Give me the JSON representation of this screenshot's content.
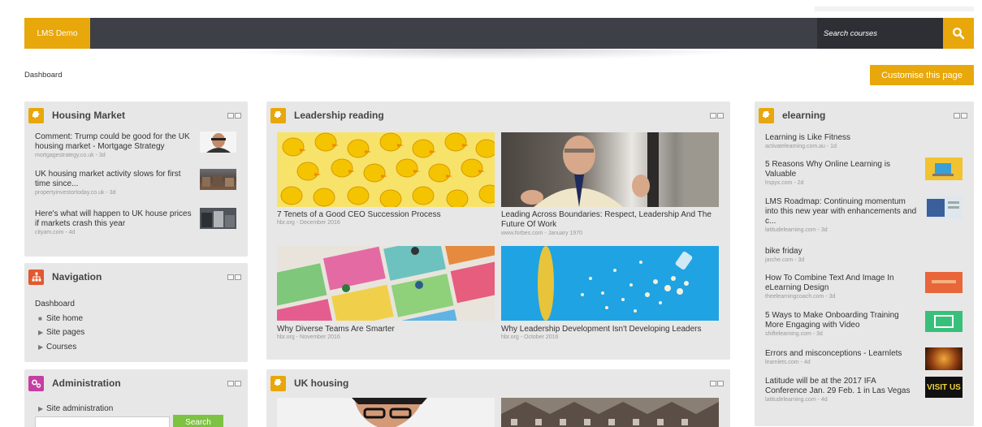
{
  "colors": {
    "accent": "#e8a70b",
    "navbar": "#3d4047",
    "panel": "#e7e7e7",
    "nav_icon": "#e2582f",
    "admin_icon": "#c63ea2",
    "go_button": "#7dc243"
  },
  "navbar": {
    "brand": "LMS Demo",
    "search_placeholder": "Search courses",
    "search_icon": "magnifier-icon"
  },
  "page": {
    "breadcrumb": "Dashboard",
    "customise_label": "Customise this page"
  },
  "housing": {
    "title": "Housing Market",
    "items": [
      {
        "title": "Comment: Trump could be good for the UK housing market - Mortgage Strategy",
        "meta": "mortgagestrategy.co.uk - 3d"
      },
      {
        "title": "UK housing market activity slows for first time since...",
        "meta": "propertyinvestortoday.co.uk - 3d"
      },
      {
        "title": "Here's what will happen to UK house prices if markets crash this year",
        "meta": "cityam.com - 4d"
      }
    ]
  },
  "navigation": {
    "title": "Navigation",
    "root": "Dashboard",
    "items": [
      {
        "label": "Site home"
      },
      {
        "label": "Site pages"
      },
      {
        "label": "Courses"
      }
    ]
  },
  "administration": {
    "title": "Administration",
    "item": "Site administration",
    "search_label": "Search"
  },
  "leadership": {
    "title": "Leadership reading",
    "cards": [
      {
        "title": "7 Tenets of a Good CEO Succession Process",
        "meta": "hbr.org - December 2016"
      },
      {
        "title": "Leading Across Boundaries: Respect, Leadership And The Future Of Work",
        "meta": "www.forbes.com - January 1970"
      },
      {
        "title": "Why Diverse Teams Are Smarter",
        "meta": "hbr.org - November 2016"
      },
      {
        "title": "Why Leadership Development Isn't Developing Leaders",
        "meta": "hbr.org - October 2016"
      }
    ]
  },
  "ukhousing": {
    "title": "UK housing"
  },
  "elearning": {
    "title": "elearning",
    "items": [
      {
        "title": "Learning is Like Fitness",
        "meta": "activatelearning.com.au - 1d"
      },
      {
        "title": "5 Reasons Why Online Learning is Valuable",
        "meta": "lrspyx.com - 2d"
      },
      {
        "title": "LMS Roadmap: Continuing momentum into this new year with enhancements and c...",
        "meta": "latitudelearning.com - 3d"
      },
      {
        "title": "bike friday",
        "meta": "jarche.com - 3d"
      },
      {
        "title": "How To Combine Text And Image In eLearning Design",
        "meta": "theelearningcoach.com - 3d"
      },
      {
        "title": "5 Ways to Make Onboarding Training More Engaging with Video",
        "meta": "shiftelearning.com - 3d"
      },
      {
        "title": "Errors and misconceptions - Learnlets",
        "meta": "learnlets.com - 4d"
      },
      {
        "title": "Latitude will be at the 2017 IFA Conference Jan. 29   Feb. 1 in Las Vegas",
        "meta": "latitudelearning.com - 4d"
      }
    ],
    "thumb_text": "VISIT US"
  }
}
